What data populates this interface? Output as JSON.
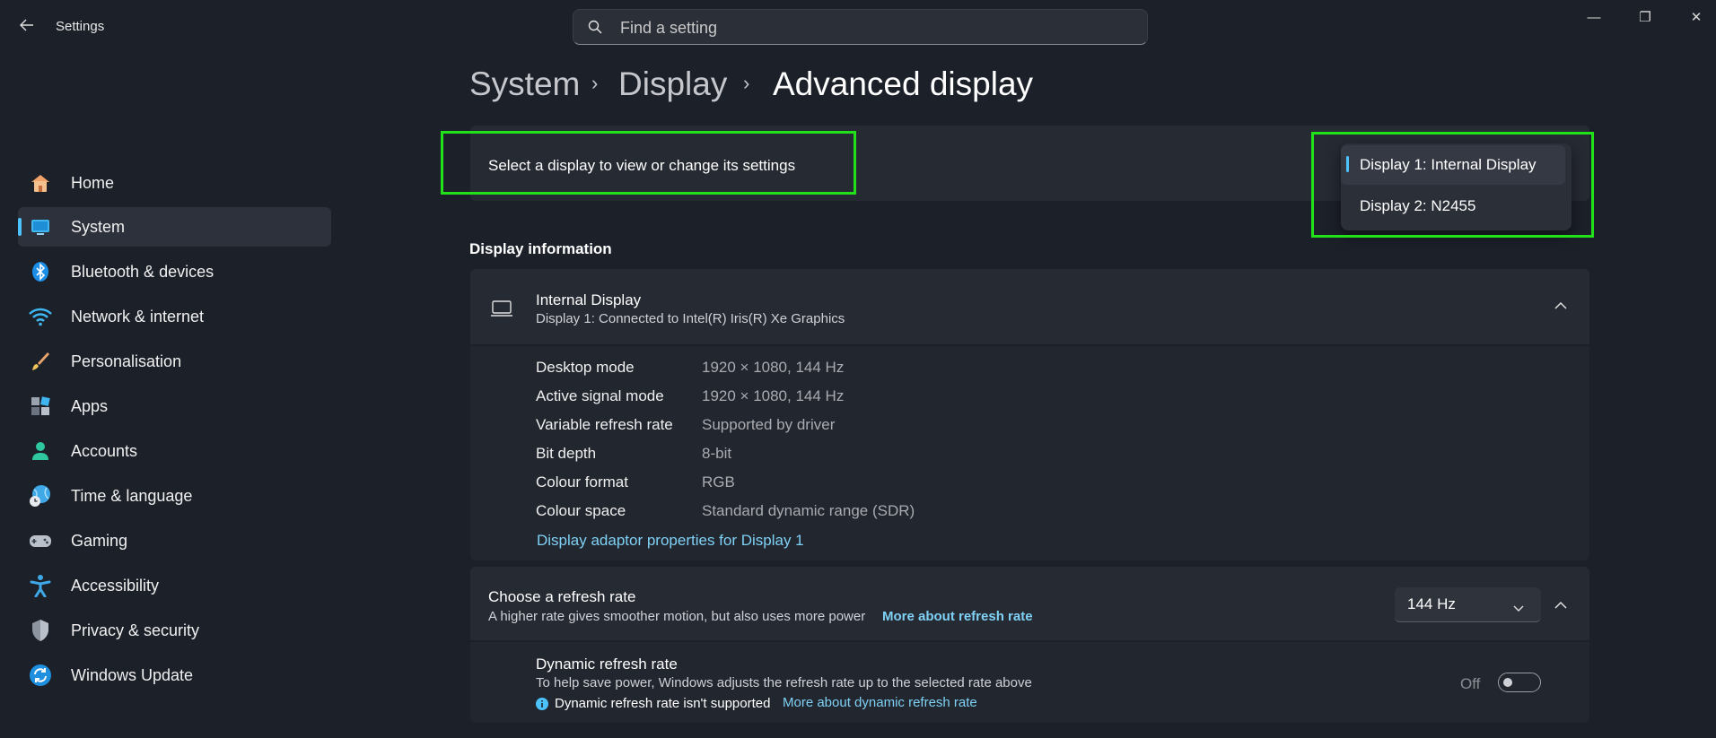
{
  "window": {
    "title": "Settings",
    "back_icon": "back-arrow-icon",
    "controls": {
      "minimize": "—",
      "maximize": "❐",
      "close": "✕"
    }
  },
  "search": {
    "placeholder": "Find a setting",
    "value": ""
  },
  "sidebar": {
    "items": [
      {
        "label": "Home",
        "icon": "home-icon"
      },
      {
        "label": "System",
        "icon": "system-icon",
        "selected": true
      },
      {
        "label": "Bluetooth & devices",
        "icon": "bluetooth-icon"
      },
      {
        "label": "Network & internet",
        "icon": "wifi-icon"
      },
      {
        "label": "Personalisation",
        "icon": "brush-icon"
      },
      {
        "label": "Apps",
        "icon": "apps-icon"
      },
      {
        "label": "Accounts",
        "icon": "person-icon"
      },
      {
        "label": "Time & language",
        "icon": "globe-clock-icon"
      },
      {
        "label": "Gaming",
        "icon": "gamepad-icon"
      },
      {
        "label": "Accessibility",
        "icon": "accessibility-icon"
      },
      {
        "label": "Privacy & security",
        "icon": "shield-icon"
      },
      {
        "label": "Windows Update",
        "icon": "update-icon"
      }
    ]
  },
  "breadcrumb": {
    "items": [
      "System",
      "Display",
      "Advanced display"
    ],
    "separator": "›"
  },
  "display_select": {
    "label": "Select a display to view or change its settings",
    "options": [
      "Display 1: Internal Display",
      "Display 2: N2455"
    ],
    "selected_index": 0
  },
  "display_info": {
    "section_title": "Display information",
    "display_name": "Internal Display",
    "display_sub": "Display 1: Connected to Intel(R) Iris(R) Xe Graphics",
    "rows": [
      {
        "label": "Desktop mode",
        "value": "1920 × 1080, 144 Hz"
      },
      {
        "label": "Active signal mode",
        "value": "1920 × 1080, 144 Hz"
      },
      {
        "label": "Variable refresh rate",
        "value": "Supported by driver"
      },
      {
        "label": "Bit depth",
        "value": "8-bit"
      },
      {
        "label": "Colour format",
        "value": "RGB"
      },
      {
        "label": "Colour space",
        "value": "Standard dynamic range (SDR)"
      }
    ],
    "adaptor_link": "Display adaptor properties for Display 1"
  },
  "refresh": {
    "title": "Choose a refresh rate",
    "desc": "A higher rate gives smoother motion, but also uses more power",
    "link": "More about refresh rate",
    "selected_rate": "144 Hz"
  },
  "dynamic_refresh": {
    "title": "Dynamic refresh rate",
    "desc": "To help save power, Windows adjusts the refresh rate up to the selected rate above",
    "note": "Dynamic refresh rate isn't supported",
    "link": "More about dynamic refresh rate",
    "toggle_state": "Off"
  },
  "colors": {
    "background": "#1c2029",
    "card": "#262a33",
    "accent": "#4cc2ff",
    "link": "#7fd1f5",
    "highlight_box": "#22e01a"
  }
}
